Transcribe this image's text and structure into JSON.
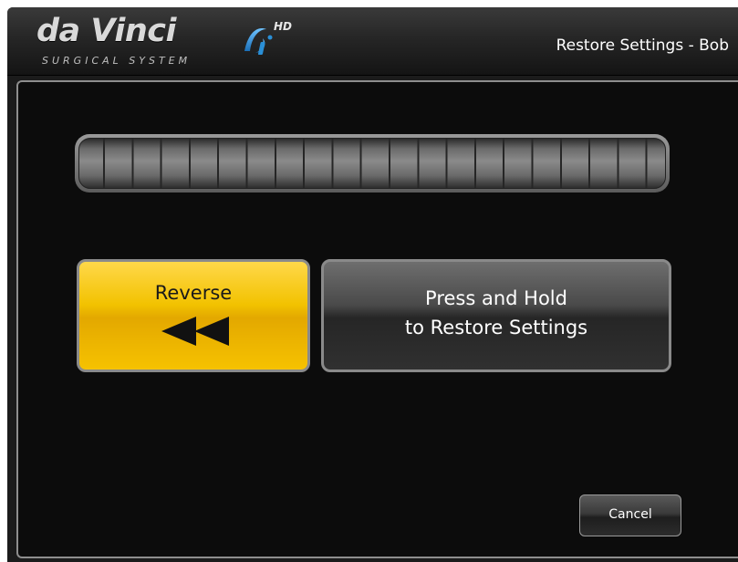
{
  "header": {
    "logo_text": "da Vinci",
    "logo_hd": "HD",
    "logo_subtitle": "SURGICAL SYSTEM",
    "title": "Restore Settings - Bob"
  },
  "progress": {
    "value": 0
  },
  "buttons": {
    "reverse_label": "Reverse",
    "reverse_icon": "rewind-icon",
    "restore_line1": "Press and Hold",
    "restore_line2": "to Restore Settings",
    "cancel_label": "Cancel"
  },
  "colors": {
    "accent_yellow": "#f2c200",
    "background": "#0c0c0c",
    "border": "#8e8e8e",
    "logo_blue": "#2a8fd6"
  }
}
